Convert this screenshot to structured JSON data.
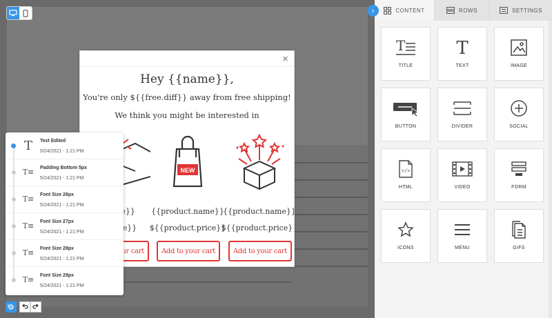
{
  "device_toggle": {
    "desktop_icon": "desktop-icon",
    "mobile_icon": "mobile-icon",
    "active": "desktop"
  },
  "popup": {
    "close": "×",
    "heading": "Hey {{name}},",
    "subheading": "You're only ${{free.diff}} away from free shipping!",
    "tagline": "We think you might be interested in",
    "products": [
      {
        "name": "{{product.name}}",
        "price": "${{product.price}}",
        "cart": "Add to your cart",
        "icon": "box-icon"
      },
      {
        "name": "{{product.name}}",
        "price": "${{product.price}}",
        "cart": "Add to your cart",
        "icon": "shopping-bag-icon",
        "badge": "NEW"
      },
      {
        "name": "{{product.name}}",
        "price": "${{product.price}}",
        "cart": "Add to your cart",
        "icon": "gift-box-icon"
      }
    ]
  },
  "history": {
    "items": [
      {
        "title": "Text Edited",
        "date": "5/24/2021 - 1:21 PM",
        "icon": "T"
      },
      {
        "title": "Padding Bottom 5px",
        "date": "5/24/2021 - 1:21 PM",
        "icon": "T≡"
      },
      {
        "title": "Font Size 26px",
        "date": "5/24/2021 - 1:21 PM",
        "icon": "T≡"
      },
      {
        "title": "Font Size 27px",
        "date": "5/24/2021 - 1:21 PM",
        "icon": "T≡"
      },
      {
        "title": "Font Size 28px",
        "date": "5/24/2021 - 1:21 PM",
        "icon": "T≡"
      },
      {
        "title": "Font Size 29px",
        "date": "5/24/2021 - 1:21 PM",
        "icon": "T≡"
      }
    ]
  },
  "history_controls": {
    "history_icon": "history-icon",
    "undo_icon": "undo-icon",
    "redo_icon": "redo-icon"
  },
  "panel": {
    "collapse": "›",
    "tabs": [
      {
        "label": "CONTENT",
        "icon": "grid-icon"
      },
      {
        "label": "ROWS",
        "icon": "rows-icon"
      },
      {
        "label": "SETTINGS",
        "icon": "settings-icon"
      }
    ],
    "blocks": [
      {
        "label": "TITLE",
        "icon": "title-icon"
      },
      {
        "label": "TEXT",
        "icon": "text-icon"
      },
      {
        "label": "IMAGE",
        "icon": "image-icon"
      },
      {
        "label": "BUTTON",
        "icon": "button-icon"
      },
      {
        "label": "DIVIDER",
        "icon": "divider-icon"
      },
      {
        "label": "SOCIAL",
        "icon": "social-icon"
      },
      {
        "label": "HTML",
        "icon": "html-icon"
      },
      {
        "label": "VIDEO",
        "icon": "video-icon"
      },
      {
        "label": "FORM",
        "icon": "form-icon"
      },
      {
        "label": "ICONS",
        "icon": "star-icon"
      },
      {
        "label": "MENU",
        "icon": "menu-icon"
      },
      {
        "label": "GIFS",
        "icon": "gifs-icon"
      }
    ]
  },
  "colors": {
    "accent": "#3a95e6",
    "cta": "#e23434"
  }
}
